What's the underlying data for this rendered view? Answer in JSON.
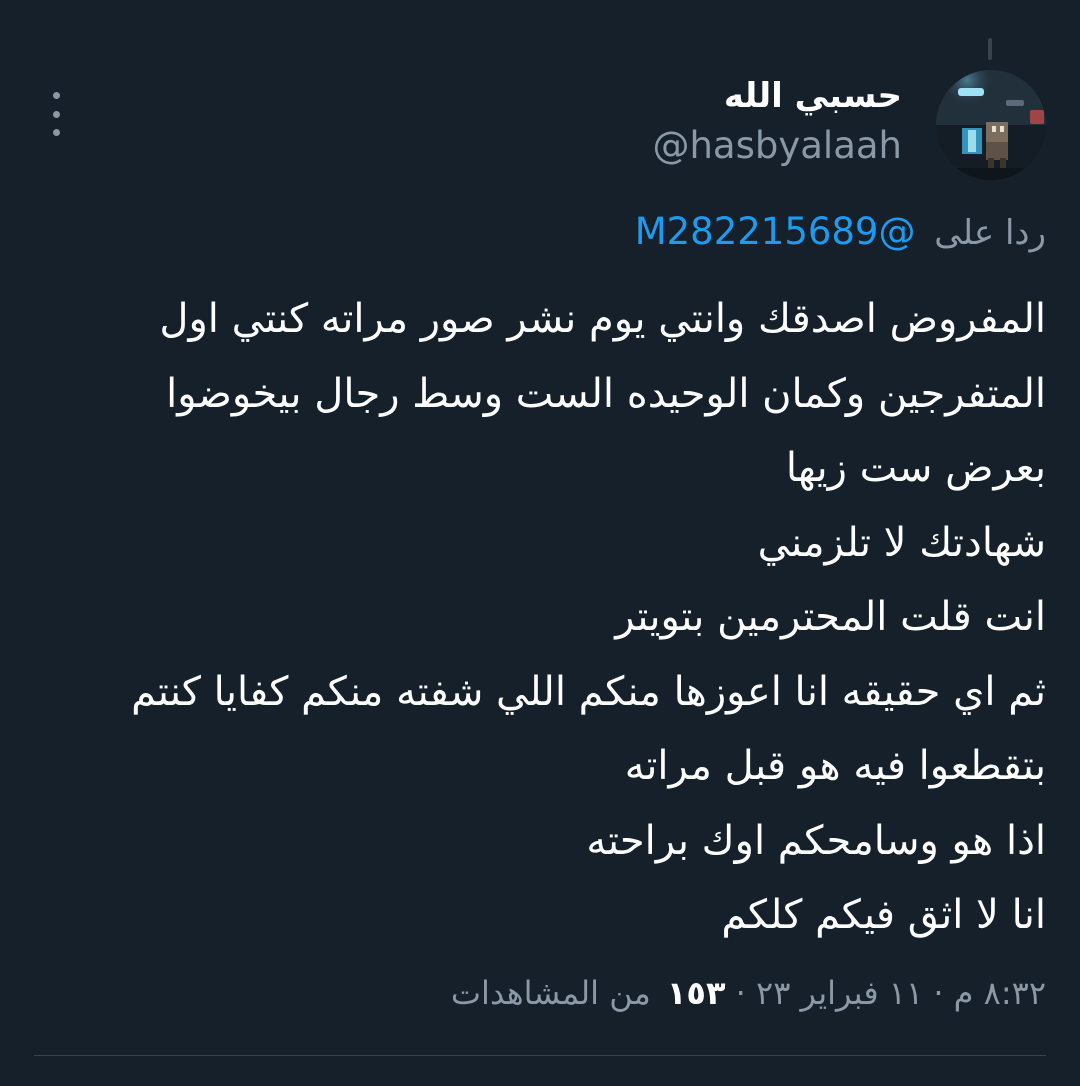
{
  "tweet": {
    "author": {
      "display_name": "حسبي الله",
      "handle": "@hasbyalaah"
    },
    "reply_to": {
      "prefix": "ردا على",
      "mention": "@M282215689"
    },
    "lines": [
      "المفروض اصدقك وانتي يوم نشر صور مراته كنتي اول",
      "المتفرجين وكمان الوحيده الست وسط رجال بيخوضوا",
      "بعرض ست زيها",
      " شهادتك لا تلزمني",
      "انت قلت المحترمين بتويتر",
      "ثم اي حقيقه انا اعوزها منكم اللي شفته منكم كفايا كنتم",
      "بتقطعوا فيه هو قبل مراته",
      "اذا هو وسامحكم اوك براحته",
      "انا لا اثق فيكم كلكم"
    ],
    "meta": {
      "time": "٨:٣٢ م",
      "separator": "·",
      "date": "١١ فبراير ٢٣",
      "views_count": "١٥٣",
      "views_label": "من المشاهدات"
    }
  },
  "icons": {
    "more": "more-vertical-icon",
    "avatar": "profile-avatar"
  },
  "colors": {
    "background": "#15202b",
    "text_primary": "#ffffff",
    "text_secondary": "#8b98a5",
    "accent": "#1d9bf0",
    "divider": "#38444d"
  }
}
